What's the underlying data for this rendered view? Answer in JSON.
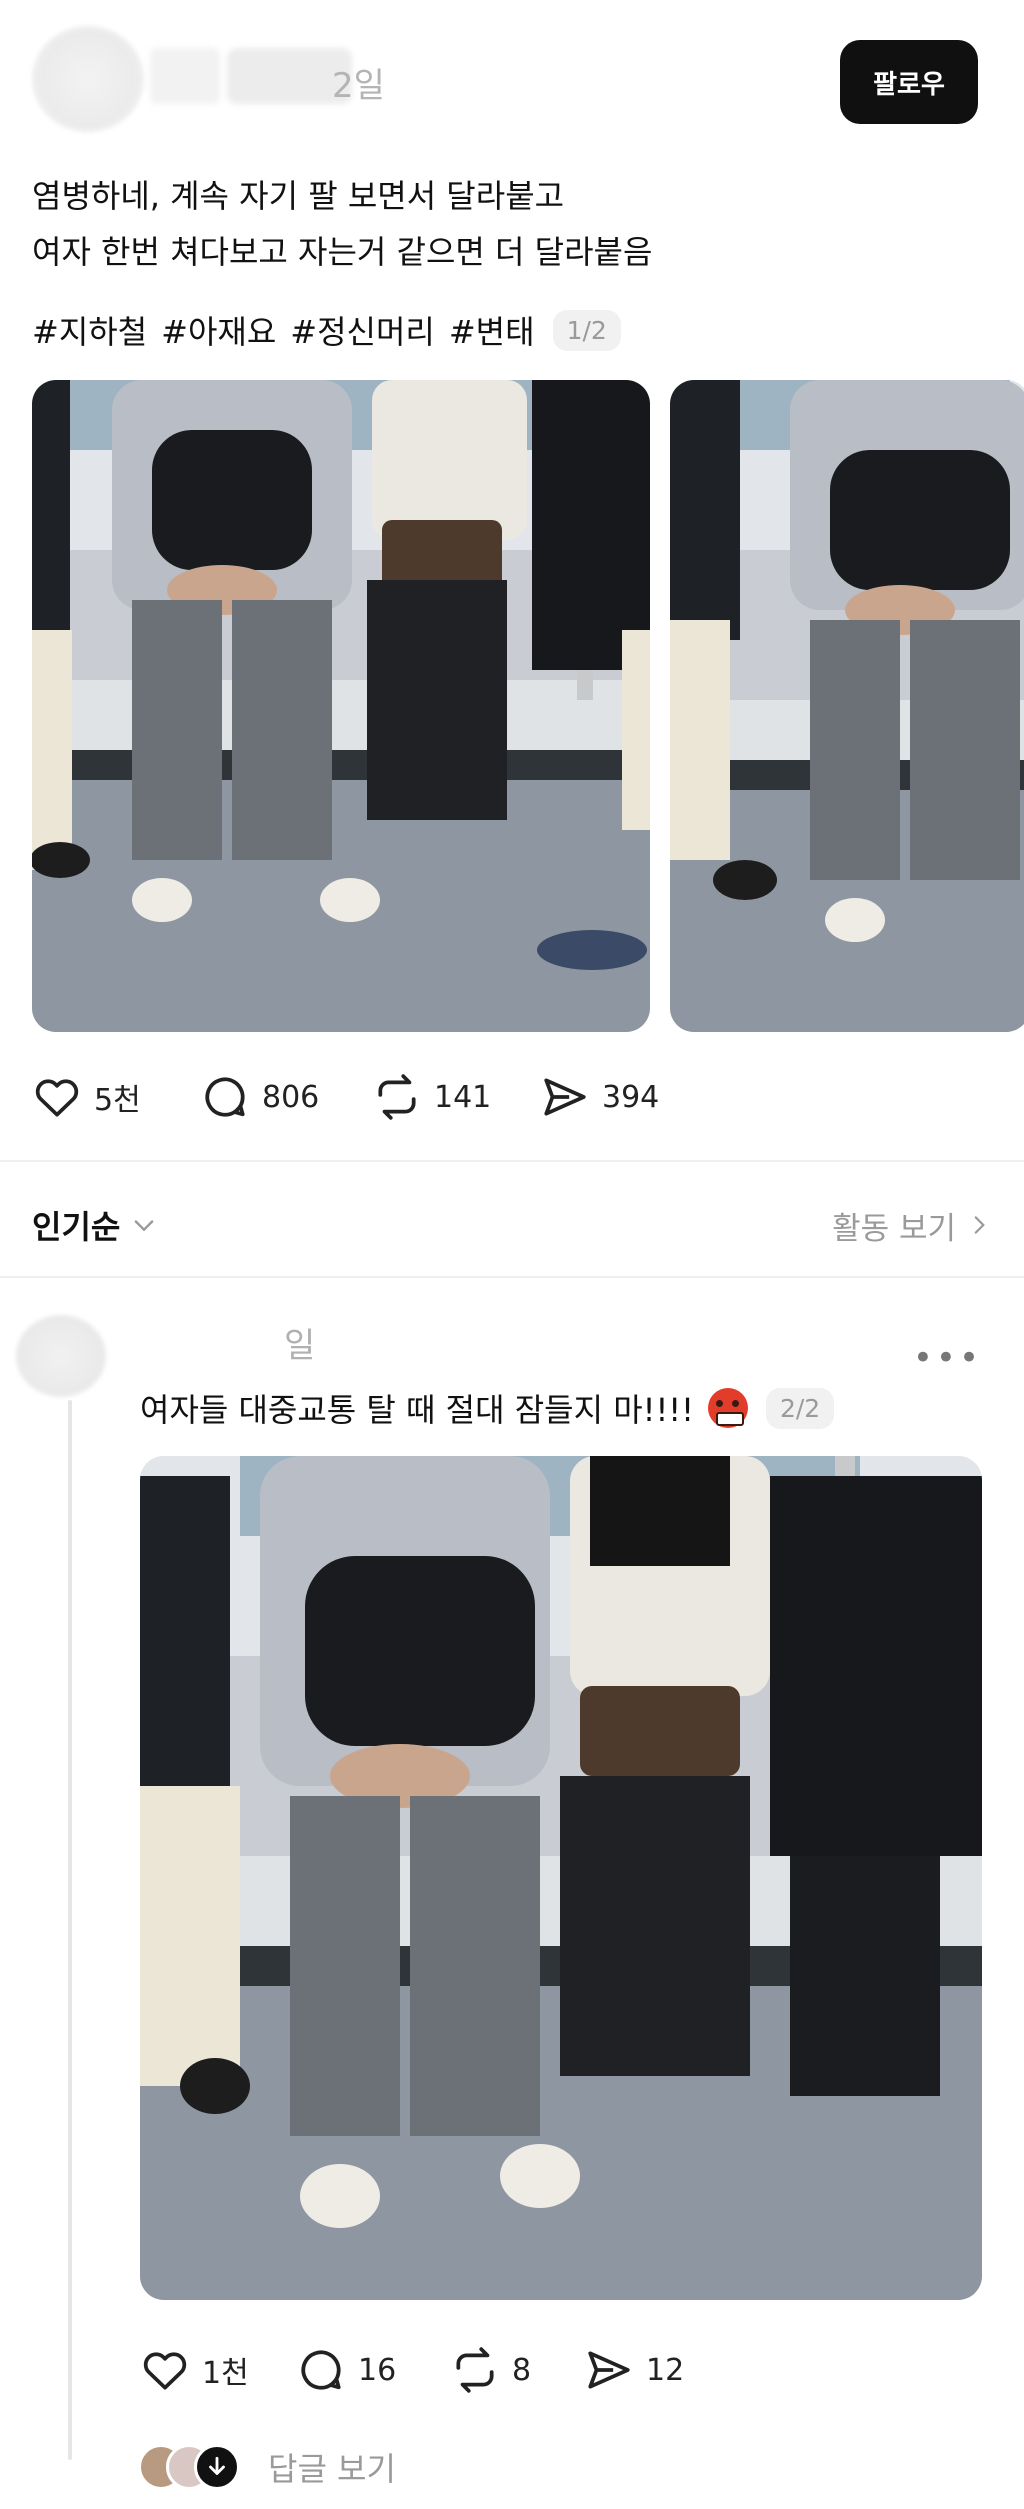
{
  "post": {
    "time": "2일",
    "follow_label": "팔로우",
    "text_lines": [
      "염병하네, 계속 자기 팔 보면서 달라붙고",
      "여자 한번 쳐다보고 자는거 같으면 더 달라붙음"
    ],
    "tags": [
      "#지하철",
      "#아재요",
      "#정신머리",
      "#변태"
    ],
    "page_badge": "1/2",
    "actions": {
      "likes": "5천",
      "comments": "806",
      "reposts": "141",
      "shares": "394"
    }
  },
  "sort": {
    "label": "인기순",
    "activity_link": "활동 보기"
  },
  "reply": {
    "time": "일",
    "more": "•••",
    "text": "여자들 대중교통 탈 때 절대 잠들지 마!!!!",
    "page_badge": "2/2",
    "actions": {
      "likes": "1천",
      "comments": "16",
      "reposts": "8",
      "shares": "12"
    },
    "replies_label": "답글 보기"
  },
  "icons": {
    "heart": "heart-icon",
    "comment": "comment-icon",
    "repost": "repost-icon",
    "share": "share-icon",
    "chevron_down": "chevron-down-icon",
    "chevron_right": "chevron-right-icon",
    "more": "more-icon",
    "emoji": "angry-face-emoji"
  },
  "colors": {
    "follow_button_bg": "#101010",
    "muted_text": "#9a9a9a",
    "badge_bg": "#f1f1f1"
  }
}
